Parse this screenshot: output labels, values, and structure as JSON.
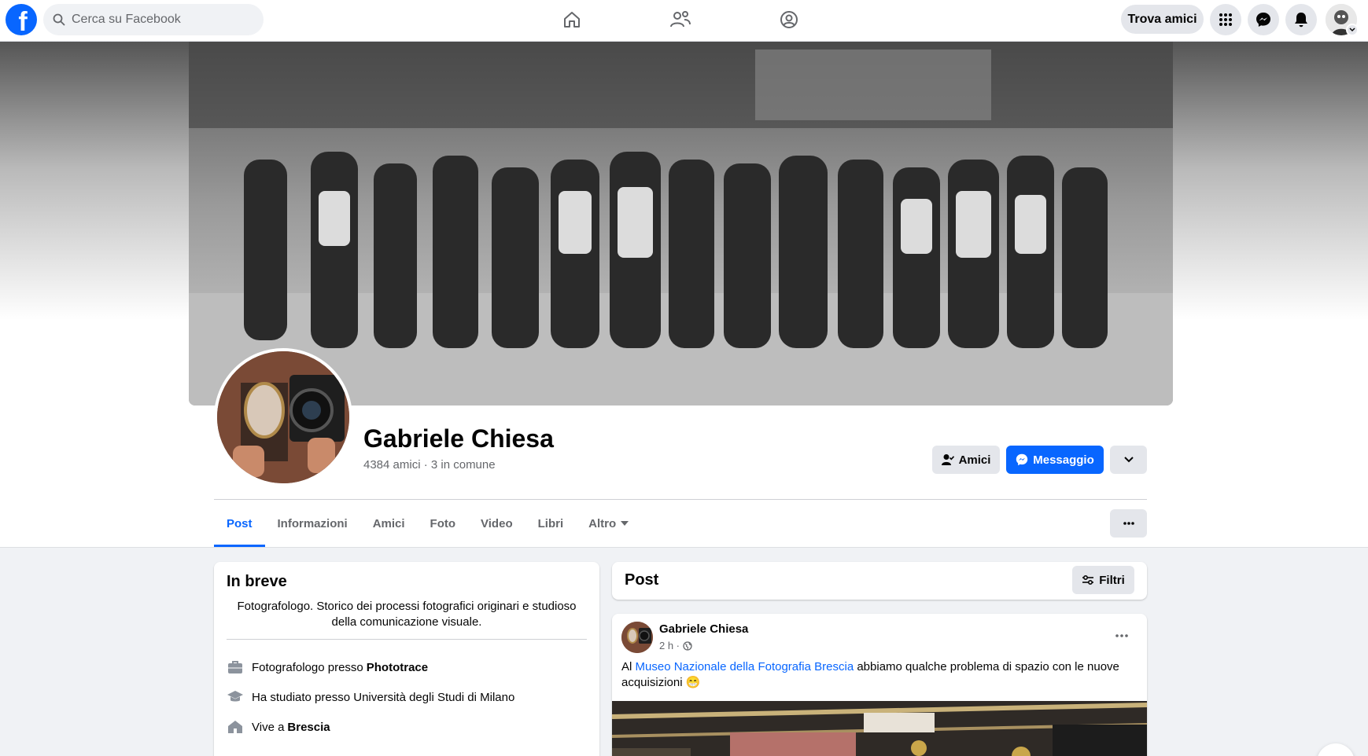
{
  "topbar": {
    "logo_letter": "f",
    "search_placeholder": "Cerca su Facebook",
    "nav_icons": [
      "home-icon",
      "friends-icon",
      "groups-icon"
    ],
    "find_friends_label": "Trova amici",
    "action_icons": [
      "menu-grid-icon",
      "messenger-icon",
      "bell-icon"
    ]
  },
  "profile": {
    "name": "Gabriele Chiesa",
    "friends_text": "4384 amici · 3 in comune",
    "buttons": {
      "friends_label": "Amici",
      "message_label": "Messaggio"
    }
  },
  "tabs": [
    {
      "label": "Post",
      "active": true
    },
    {
      "label": "Informazioni"
    },
    {
      "label": "Amici"
    },
    {
      "label": "Foto"
    },
    {
      "label": "Video"
    },
    {
      "label": "Libri"
    },
    {
      "label": "Altro"
    }
  ],
  "intro": {
    "title": "In breve",
    "bio": "Fotografologo. Storico dei processi fotografici originari e studioso della comunicazione visuale.",
    "rows": [
      {
        "icon": "briefcase-icon",
        "text": "Fotografologo presso",
        "bold": "Phototrace"
      },
      {
        "icon": "graduation-cap-icon",
        "text": "Ha studiato presso Università degli Studi di Milano",
        "bold": ""
      },
      {
        "icon": "house-icon",
        "text": "Vive a",
        "bold": "Brescia"
      }
    ]
  },
  "posts_section": {
    "title": "Post",
    "filters_label": "Filtri"
  },
  "post": {
    "author": "Gabriele Chiesa",
    "time": "2 h ·",
    "text_prefix": "Al",
    "link_text": "Museo Nazionale della Fotografia Brescia",
    "text_suffix": "abbiamo qualche problema di spazio con le nuove acquisizioni 😁"
  },
  "colors": {
    "brand_blue": "#0866ff",
    "button_gray": "#e4e6eb",
    "secondary_text": "#65676b"
  }
}
